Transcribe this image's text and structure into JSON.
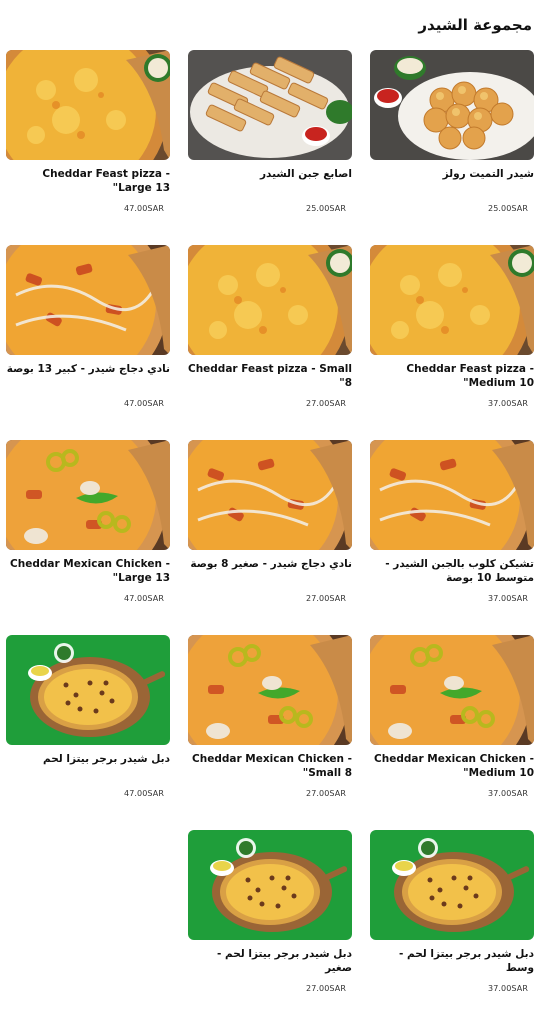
{
  "page": {
    "title": "مجموعة الشيدر"
  },
  "products": [
    {
      "name": "شيدر التميت رولز",
      "price": "25.00SAR",
      "image": "cheese-rolls"
    },
    {
      "name": "اصابع جبن الشيدر",
      "price": "25.00SAR",
      "image": "cheese-sticks"
    },
    {
      "name": "Cheddar Feast pizza - Large 13\"",
      "price": "47.00SAR",
      "image": "cheese-pizza"
    },
    {
      "name": "Cheddar Feast pizza - Medium 10\"",
      "price": "37.00SAR",
      "image": "cheese-pizza"
    },
    {
      "name": "Cheddar Feast pizza - Small 8\"",
      "price": "27.00SAR",
      "image": "cheese-pizza"
    },
    {
      "name": "نادي دجاج شيدر - كبير 13 بوصة",
      "price": "47.00SAR",
      "image": "chicken-pizza"
    },
    {
      "name": "تشيكن كلوب بالجبن الشيدر - متوسط 10 بوصة",
      "price": "37.00SAR",
      "image": "chicken-pizza"
    },
    {
      "name": "نادي دجاج شيدر - صغير 8 بوصة",
      "price": "27.00SAR",
      "image": "chicken-pizza"
    },
    {
      "name": "Cheddar Mexican Chicken - Large 13\"",
      "price": "47.00SAR",
      "image": "mexican-pizza"
    },
    {
      "name": "Cheddar Mexican Chicken - Medium 10\"",
      "price": "37.00SAR",
      "image": "mexican-pizza"
    },
    {
      "name": "Cheddar Mexican Chicken - Small 8\"",
      "price": "27.00SAR",
      "image": "mexican-pizza"
    },
    {
      "name": "دبل شيدر برجر بيتزا لحم",
      "price": "47.00SAR",
      "image": "burger-pizza"
    },
    {
      "name": "دبل شيدر برجر بيتزا لحم - وسط",
      "price": "37.00SAR",
      "image": "burger-pizza"
    },
    {
      "name": "دبل شيدر برجر بيتزا لحم - صغير",
      "price": "27.00SAR",
      "image": "burger-pizza"
    }
  ]
}
